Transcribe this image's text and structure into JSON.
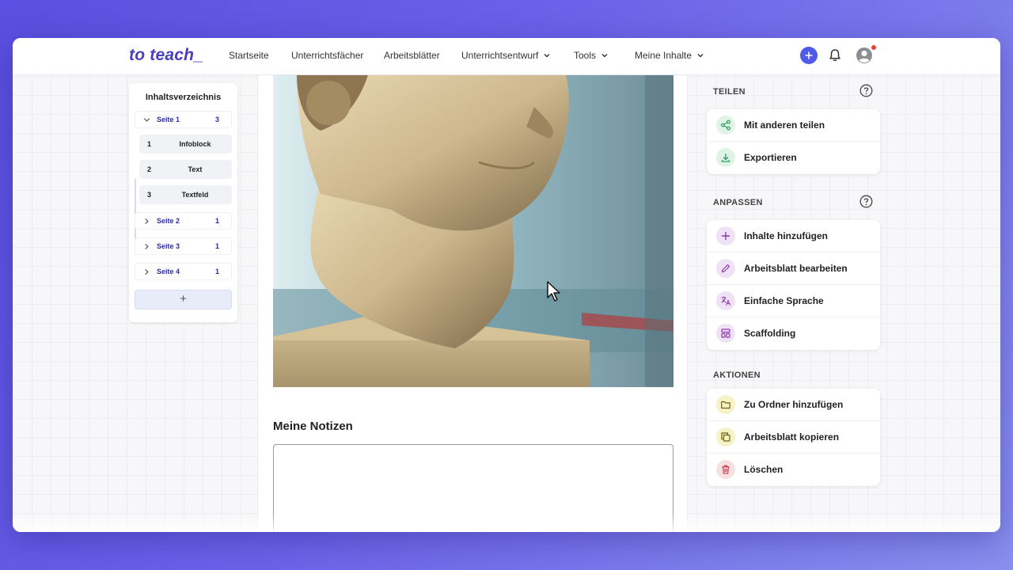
{
  "app": {
    "logo": "to teach_"
  },
  "nav": {
    "items": [
      {
        "label": "Startseite",
        "dropdown": false
      },
      {
        "label": "Unterrichtsfächer",
        "dropdown": false
      },
      {
        "label": "Arbeitsblätter",
        "dropdown": false
      },
      {
        "label": "Unterrichtsentwurf",
        "dropdown": true
      },
      {
        "label": "Tools",
        "dropdown": true
      },
      {
        "label": "Meine Inhalte",
        "dropdown": true
      }
    ],
    "icons": [
      "plus-icon",
      "bell-icon",
      "user-avatar-icon"
    ]
  },
  "toc": {
    "title": "Inhaltsverzeichnis",
    "pages": [
      {
        "label": "Seite 1",
        "count": "3",
        "expanded": true,
        "items": [
          {
            "num": "1",
            "label": "Infoblock"
          },
          {
            "num": "2",
            "label": "Text"
          },
          {
            "num": "3",
            "label": "Textfeld"
          }
        ]
      },
      {
        "label": "Seite 2",
        "count": "1",
        "expanded": false
      },
      {
        "label": "Seite 3",
        "count": "1",
        "expanded": false
      },
      {
        "label": "Seite 4",
        "count": "1",
        "expanded": false
      }
    ],
    "add_label": "+"
  },
  "content": {
    "image_subject": "marble-bust-photo",
    "notes_title": "Meine Notizen",
    "notes_value": ""
  },
  "panel": {
    "share": {
      "heading": "TEILEN",
      "actions": [
        {
          "label": "Mit anderen teilen",
          "icon": "share-icon",
          "color": "#2f9a5c"
        },
        {
          "label": "Exportieren",
          "icon": "download-icon",
          "color": "#2f9a5c"
        }
      ]
    },
    "customize": {
      "heading": "ANPASSEN",
      "actions": [
        {
          "label": "Inhalte hinzufügen",
          "icon": "plus-icon",
          "color": "#8b3aa8"
        },
        {
          "label": "Arbeitsblatt bearbeiten",
          "icon": "pencil-icon",
          "color": "#8b3aa8"
        },
        {
          "label": "Einfache Sprache",
          "icon": "translate-icon",
          "color": "#8b3aa8"
        },
        {
          "label": "Scaffolding",
          "icon": "layout-icon",
          "color": "#8b3aa8"
        }
      ]
    },
    "actions": {
      "heading": "AKTIONEN",
      "actions": [
        {
          "label": "Zu Ordner hinzufügen",
          "icon": "folder-icon",
          "color": "#8a7a10"
        },
        {
          "label": "Arbeitsblatt kopieren",
          "icon": "copy-icon",
          "color": "#8a7a10"
        },
        {
          "label": "Löschen",
          "icon": "trash-icon",
          "color": "#c0303c"
        }
      ]
    }
  },
  "colors": {
    "brand": "#4a3fbf",
    "accent": "#4f5be8",
    "notification": "#e8413c"
  }
}
